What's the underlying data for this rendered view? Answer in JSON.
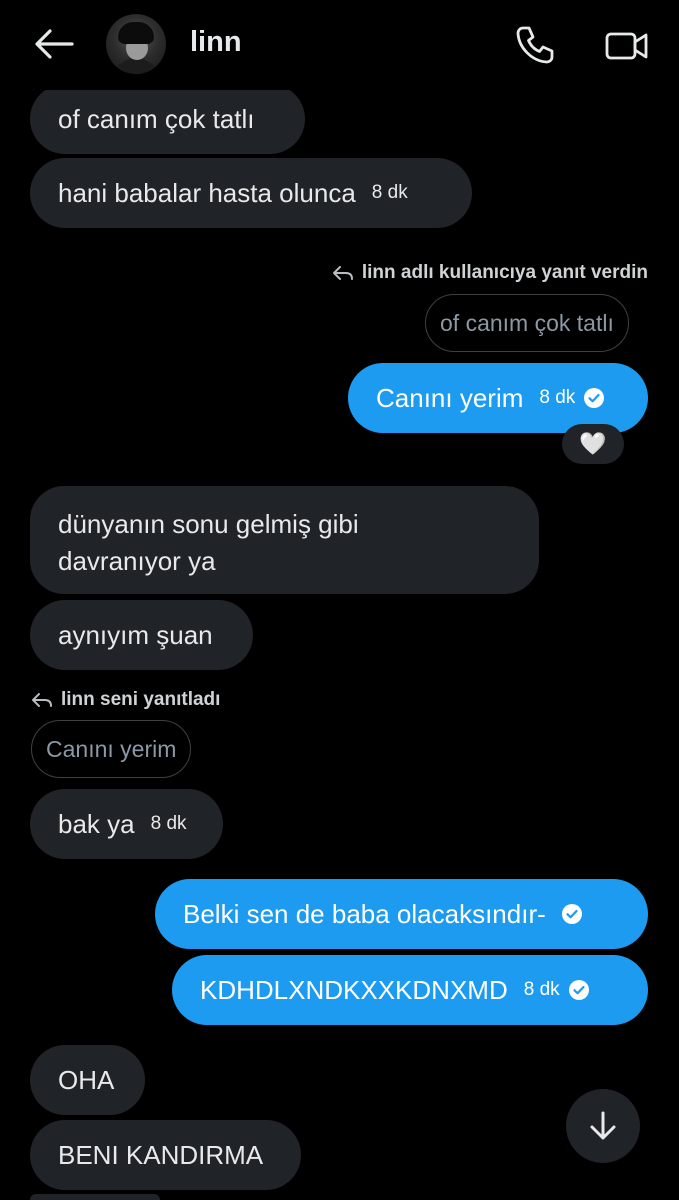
{
  "header": {
    "title": "linn",
    "back_icon": "arrow-left-icon",
    "call_icon": "phone-icon",
    "video_icon": "video-camera-icon"
  },
  "colors": {
    "background": "#000000",
    "incoming_bubble": "#202327",
    "outgoing_bubble": "#1d9bf0",
    "text": "#e7e9ea"
  },
  "messages": {
    "m1": {
      "text": "of canım çok tatlı"
    },
    "m2": {
      "text": "hani babalar hasta olunca",
      "time": "8 dk"
    },
    "reply1": {
      "context": "linn adlı kullanıcıya yanıt verdin",
      "quote": "of canım çok tatlı"
    },
    "m3": {
      "text": "Canını yerim",
      "time": "8 dk",
      "reaction": "🤍"
    },
    "m4": {
      "line1": "dünyanın sonu gelmiş gibi",
      "line2": "davranıyor ya"
    },
    "m5": {
      "text": "aynıyım şuan"
    },
    "reply2": {
      "context": "linn seni yanıtladı",
      "quote": "Canını yerim"
    },
    "m6": {
      "text": "bak ya",
      "time": "8 dk"
    },
    "m7": {
      "text": "Belki sen de baba olacaksındır-"
    },
    "m8": {
      "text": "KDHDLXNDKXXKDNXMD",
      "time": "8 dk"
    },
    "m9": {
      "text": "OHA"
    },
    "m10": {
      "text": "BENI KANDIRMA"
    }
  },
  "scroll_button_icon": "arrow-down-icon"
}
